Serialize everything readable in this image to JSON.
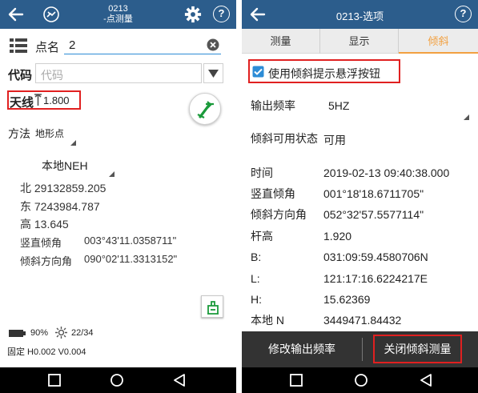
{
  "left": {
    "title_line1": "0213",
    "title_line2": "-点测量",
    "point_name_label": "点名",
    "point_name_value": "2",
    "code_label": "代码",
    "code_placeholder": "代码",
    "antenna_label": "天线",
    "antenna_value": "1.800",
    "method_label": "方法",
    "method_value": "地形点",
    "coord_system": "本地NEH",
    "north": "北 29132859.205",
    "east": "东 7243984.787",
    "height": "高 13.645",
    "vert_tilt_label": "竖直倾角",
    "vert_tilt_value": "003°43'11.0358711\"",
    "tilt_dir_label": "倾斜方向角",
    "tilt_dir_value": "090°02'11.3313152\"",
    "battery": "90%",
    "satellites": "22/34",
    "status": "固定 H0.002 V0.004"
  },
  "right": {
    "title": "0213-选项",
    "tabs": [
      "测量",
      "显示",
      "倾斜"
    ],
    "active_tab": 2,
    "checkbox_label": "使用倾斜提示悬浮按钮",
    "output_freq_label": "输出频率",
    "output_freq_value": "5HZ",
    "tilt_available_label": "倾斜可用状态",
    "tilt_available_value": "可用",
    "rows": [
      {
        "label": "时间",
        "value": "2019-02-13 09:40:38.000"
      },
      {
        "label": "竖直倾角",
        "value": "001°18'18.6711705\""
      },
      {
        "label": "倾斜方向角",
        "value": "052°32'57.5577114\""
      },
      {
        "label": "杆高",
        "value": "1.920"
      },
      {
        "label": "B:",
        "value": "031:09:59.4580706N"
      },
      {
        "label": "L:",
        "value": "121:17:16.6224217E"
      },
      {
        "label": "H:",
        "value": "15.62369"
      },
      {
        "label": "本地 N",
        "value": "3449471.84432"
      }
    ],
    "btn_modify": "修改输出频率",
    "btn_close": "关闭倾斜测量"
  },
  "colors": {
    "titlebar": "#2c5d8c",
    "accent": "#f2a040",
    "link": "#2c8cd6",
    "highlight": "#e02020",
    "bottom_bar": "#333333"
  }
}
